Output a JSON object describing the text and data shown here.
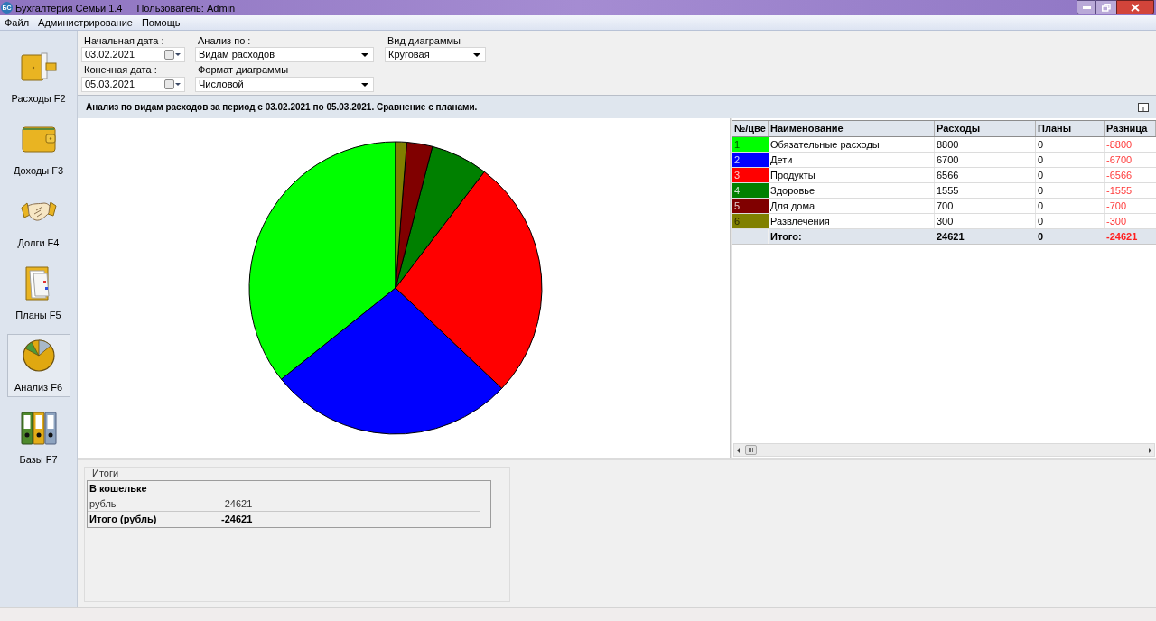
{
  "window": {
    "logo": "БС",
    "title": "Бухгалтерия Семьи 1.4",
    "user": "Пользователь: Admin"
  },
  "menu": [
    "Файл",
    "Администрирование",
    "Помощь"
  ],
  "sidebar": {
    "items": [
      {
        "label": "Расходы F2",
        "kind": "expenses",
        "selected": false
      },
      {
        "label": "Доходы F3",
        "kind": "income",
        "selected": false
      },
      {
        "label": "Долги F4",
        "kind": "debts",
        "selected": false
      },
      {
        "label": "Планы F5",
        "kind": "plans",
        "selected": false
      },
      {
        "label": "Анализ F6",
        "kind": "analysis",
        "selected": true
      },
      {
        "label": "Базы F7",
        "kind": "databases",
        "selected": false
      }
    ]
  },
  "filters": {
    "start_date": {
      "label": "Начальная дата :",
      "value": "03.02.2021"
    },
    "end_date": {
      "label": "Конечная дата :",
      "value": "05.03.2021"
    },
    "analysis_by": {
      "label": "Анализ по :",
      "value": "Видам расходов"
    },
    "chart_format": {
      "label": "Формат диаграммы",
      "value": "Числовой"
    },
    "chart_type": {
      "label": "Вид диаграммы",
      "value": "Круговая"
    }
  },
  "report": {
    "title": "Анализ по видам расходов за период с 03.02.2021 по 05.03.2021. Сравнение с планами."
  },
  "chart": {
    "chart_data": {
      "type": "pie",
      "values": [
        35.74,
        27.21,
        26.67,
        6.32,
        2.84,
        1.22
      ]
    }
  },
  "table": {
    "columns": [
      "№/цве",
      "Наименование",
      "Расходы",
      "Планы",
      "Разница"
    ],
    "rows": [
      {
        "number": "1",
        "color": "#00ff00",
        "name": "Обязательные расходы",
        "expenses": "8800",
        "plans": "0",
        "difference": "-8800"
      },
      {
        "number": "2",
        "color": "#0000ff",
        "name": "Дети",
        "expenses": "6700",
        "plans": "0",
        "difference": "-6700"
      },
      {
        "number": "3",
        "color": "#ff0000",
        "name": "Продукты",
        "expenses": "6566",
        "plans": "0",
        "difference": "-6566"
      },
      {
        "number": "4",
        "color": "#008000",
        "name": "Здоровье",
        "expenses": "1555",
        "plans": "0",
        "difference": "-1555"
      },
      {
        "number": "5",
        "color": "#800000",
        "name": "Для дома",
        "expenses": "700",
        "plans": "0",
        "difference": "-700"
      },
      {
        "number": "6",
        "color": "#808000",
        "name": "Развлечения",
        "expenses": "300",
        "plans": "0",
        "difference": "-300"
      }
    ],
    "total": {
      "label": "Итого:",
      "expenses": "24621",
      "plans": "0",
      "difference": "-24621"
    }
  },
  "totals": {
    "title": "Итоги",
    "section": "В кошельке",
    "rows": [
      {
        "kind": "line",
        "label": "рубль",
        "value": "-24621"
      },
      {
        "kind": "total",
        "label": "Итого (рубль)",
        "value": "-24621"
      }
    ]
  }
}
